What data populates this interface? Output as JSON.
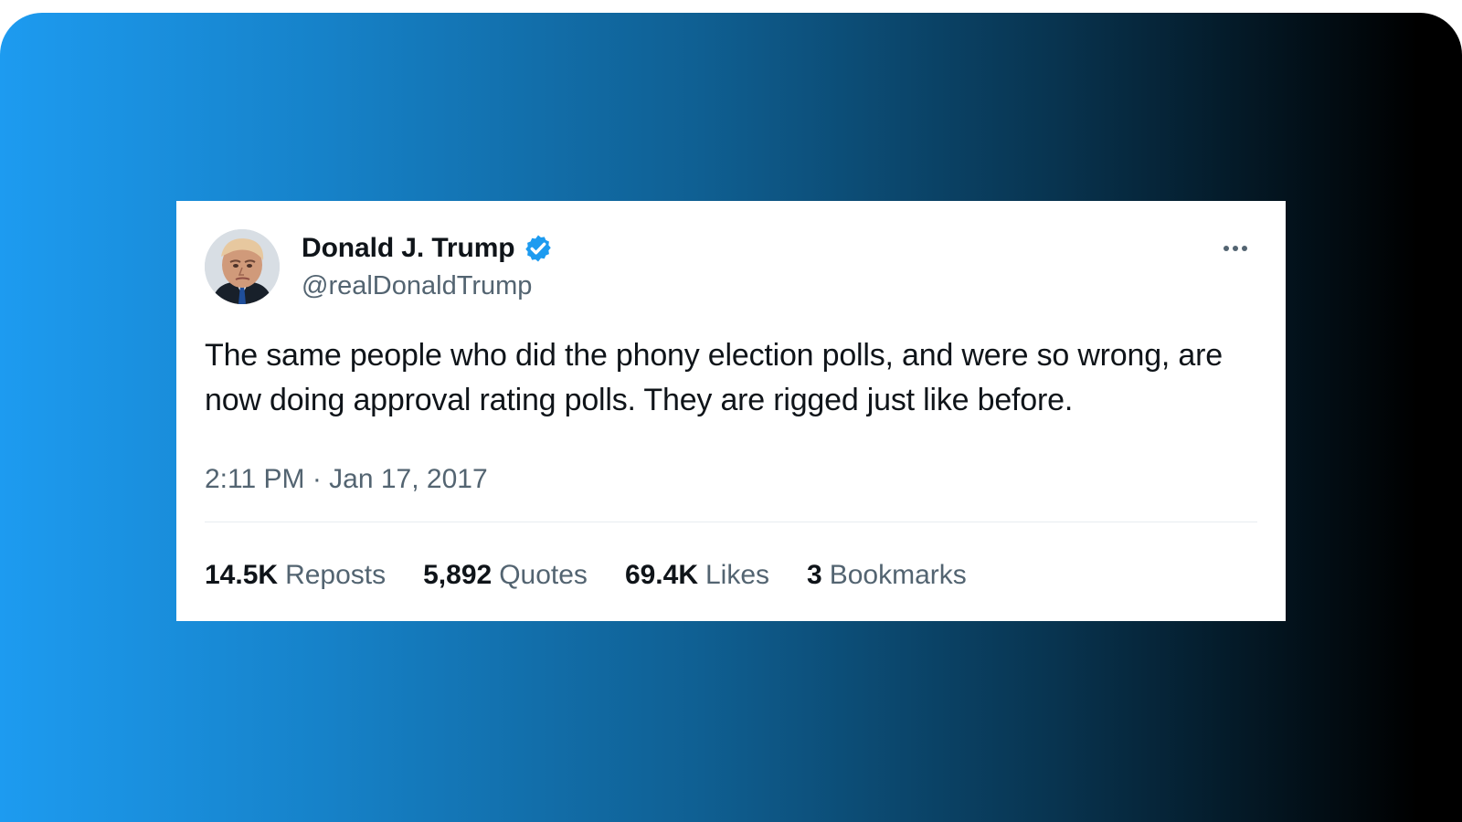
{
  "tweet": {
    "author": {
      "display_name": "Donald J. Trump",
      "handle": "@realDonaldTrump",
      "verified_icon": "verified-badge-icon",
      "avatar": "profile-photo"
    },
    "menu_icon": "more-options-icon",
    "text": "The same people who did the phony election polls, and were so wrong, are now doing approval rating polls. They are rigged just like before.",
    "timestamp": "2:11 PM · Jan 17, 2017",
    "stats": [
      {
        "count": "14.5K",
        "label": "Reposts"
      },
      {
        "count": "5,892",
        "label": "Quotes"
      },
      {
        "count": "69.4K",
        "label": "Likes"
      },
      {
        "count": "3",
        "label": "Bookmarks"
      }
    ]
  },
  "colors": {
    "gradient_start": "#1d9bf0",
    "gradient_end": "#000000",
    "verified_blue": "#1d9bf0",
    "text_primary": "#0f1419",
    "text_secondary": "#536471",
    "divider": "#e7ecf0"
  }
}
